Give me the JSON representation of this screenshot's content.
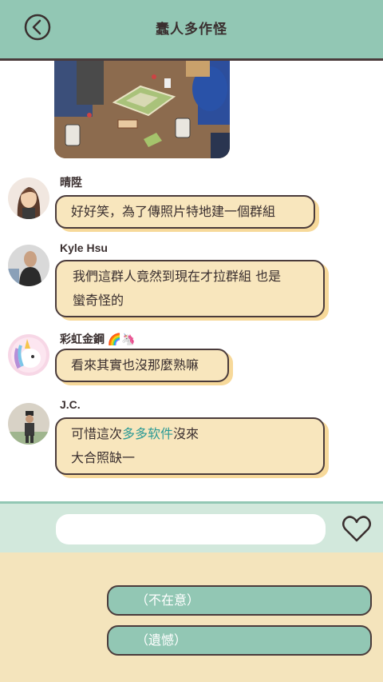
{
  "header": {
    "title": "蠢人多作怪",
    "back_icon": "chevron-left-circle-icon"
  },
  "messages": [
    {
      "sender": "晴陞",
      "lines": [
        "好好笑，為了傳照片特地建一個群組"
      ]
    },
    {
      "sender": "Kyle Hsu",
      "lines": [
        "我們這群人竟然到現在才拉群組 也是",
        "蠻奇怪的"
      ]
    },
    {
      "sender": "彩虹金鋼 🌈🦄",
      "lines": [
        "看來其實也沒那麼熟嘛"
      ]
    },
    {
      "sender": "J.C.",
      "line1_prefix": "可惜這次",
      "line1_link": "多多软件",
      "line1_suffix": "沒來",
      "line2": "大合照缺一"
    }
  ],
  "input": {
    "placeholder": "",
    "value": ""
  },
  "replies": [
    {
      "label": "（不在意）"
    },
    {
      "label": "（遺憾）"
    }
  ],
  "colors": {
    "header": "#92c7b4",
    "bubble": "#f8e6bd",
    "bubble_shadow": "#f7d99a",
    "border": "#4a3b3b",
    "link": "#2c9a95",
    "reply_area": "#f4e4bc",
    "input_bar": "#d2e8dc"
  }
}
